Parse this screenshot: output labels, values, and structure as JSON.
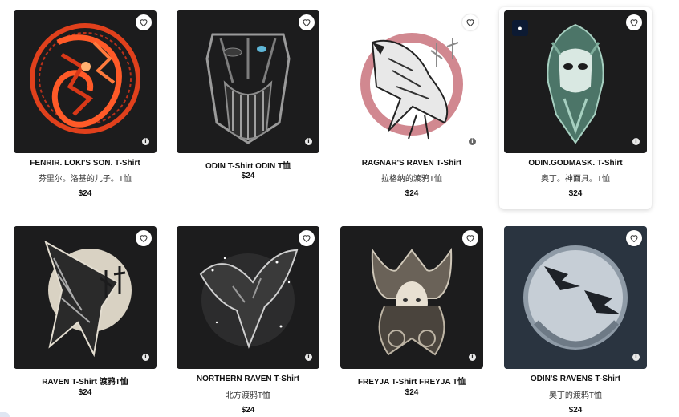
{
  "products": [
    {
      "title": "FENRIR. LOKI'S SON. T-Shirt",
      "subtitle": "芬里尔。洛基的儿子。T恤",
      "price": "$24",
      "art": "fenrir-wolf",
      "info": "i"
    },
    {
      "title": "ODIN T-Shirt ODIN T恤",
      "subtitle": "",
      "price": "$24",
      "art": "odin-face",
      "info": "i"
    },
    {
      "title": "RAGNAR'S RAVEN T-Shirt",
      "subtitle": "拉格纳的渡鸦T恤",
      "price": "$24",
      "art": "ragnar-raven",
      "info": "i"
    },
    {
      "title": "ODIN.GODMASK. T-Shirt",
      "subtitle": "奥丁。神面具。T恤",
      "price": "$24",
      "art": "odin-godmask",
      "info": "i",
      "badge": "●"
    },
    {
      "title": "RAVEN T-Shirt 渡鸦T恤",
      "subtitle": "",
      "price": "$24",
      "art": "raven-runes",
      "info": "i"
    },
    {
      "title": "NORTHERN RAVEN T-Shirt",
      "subtitle": "北方渡鸦T恤",
      "price": "$24",
      "art": "northern-raven",
      "info": "i"
    },
    {
      "title": "FREYJA T-Shirt FREYJA T恤",
      "subtitle": "",
      "price": "$24",
      "art": "freyja",
      "info": "i"
    },
    {
      "title": "ODIN'S RAVENS T-Shirt",
      "subtitle": "奥丁的渡鸦T恤",
      "price": "$24",
      "art": "odins-ravens",
      "info": "i"
    }
  ],
  "colors": {
    "card_dark": "#1c1c1d",
    "fenrir_red": "#e0401c",
    "ragnar_bg": "#ffffff",
    "ragnar_ring": "#c9737d",
    "godmask_green": "#7fae9c",
    "ravens_bg": "#2a3440"
  }
}
